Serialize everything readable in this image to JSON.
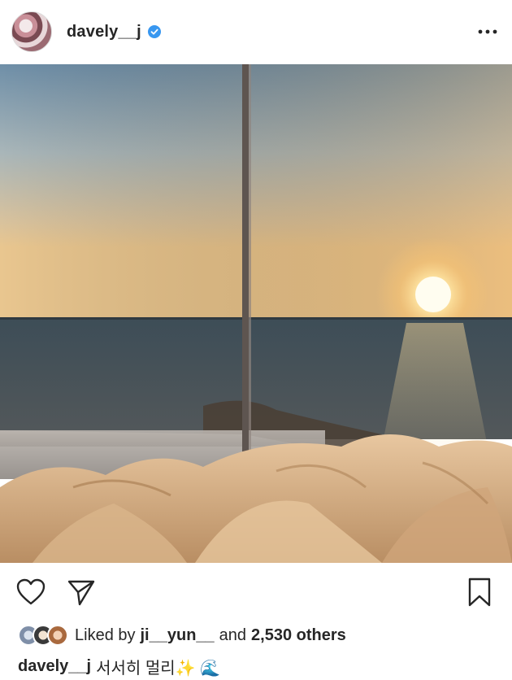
{
  "post": {
    "username": "davely__j",
    "verified_icon": "verified-badge-icon",
    "more_icon": "more-options-icon"
  },
  "actions": {
    "like_icon": "heart-icon",
    "share_icon": "paper-plane-icon",
    "save_icon": "bookmark-icon"
  },
  "likes": {
    "prefix": "Liked by",
    "user": "ji__yun__",
    "middle": "and",
    "others": "2,530 others"
  },
  "caption": {
    "username": "davely__j",
    "text": "서서히 멀리✨ 🌊"
  },
  "colors": {
    "text": "#262626",
    "verified": "#3897f0"
  }
}
